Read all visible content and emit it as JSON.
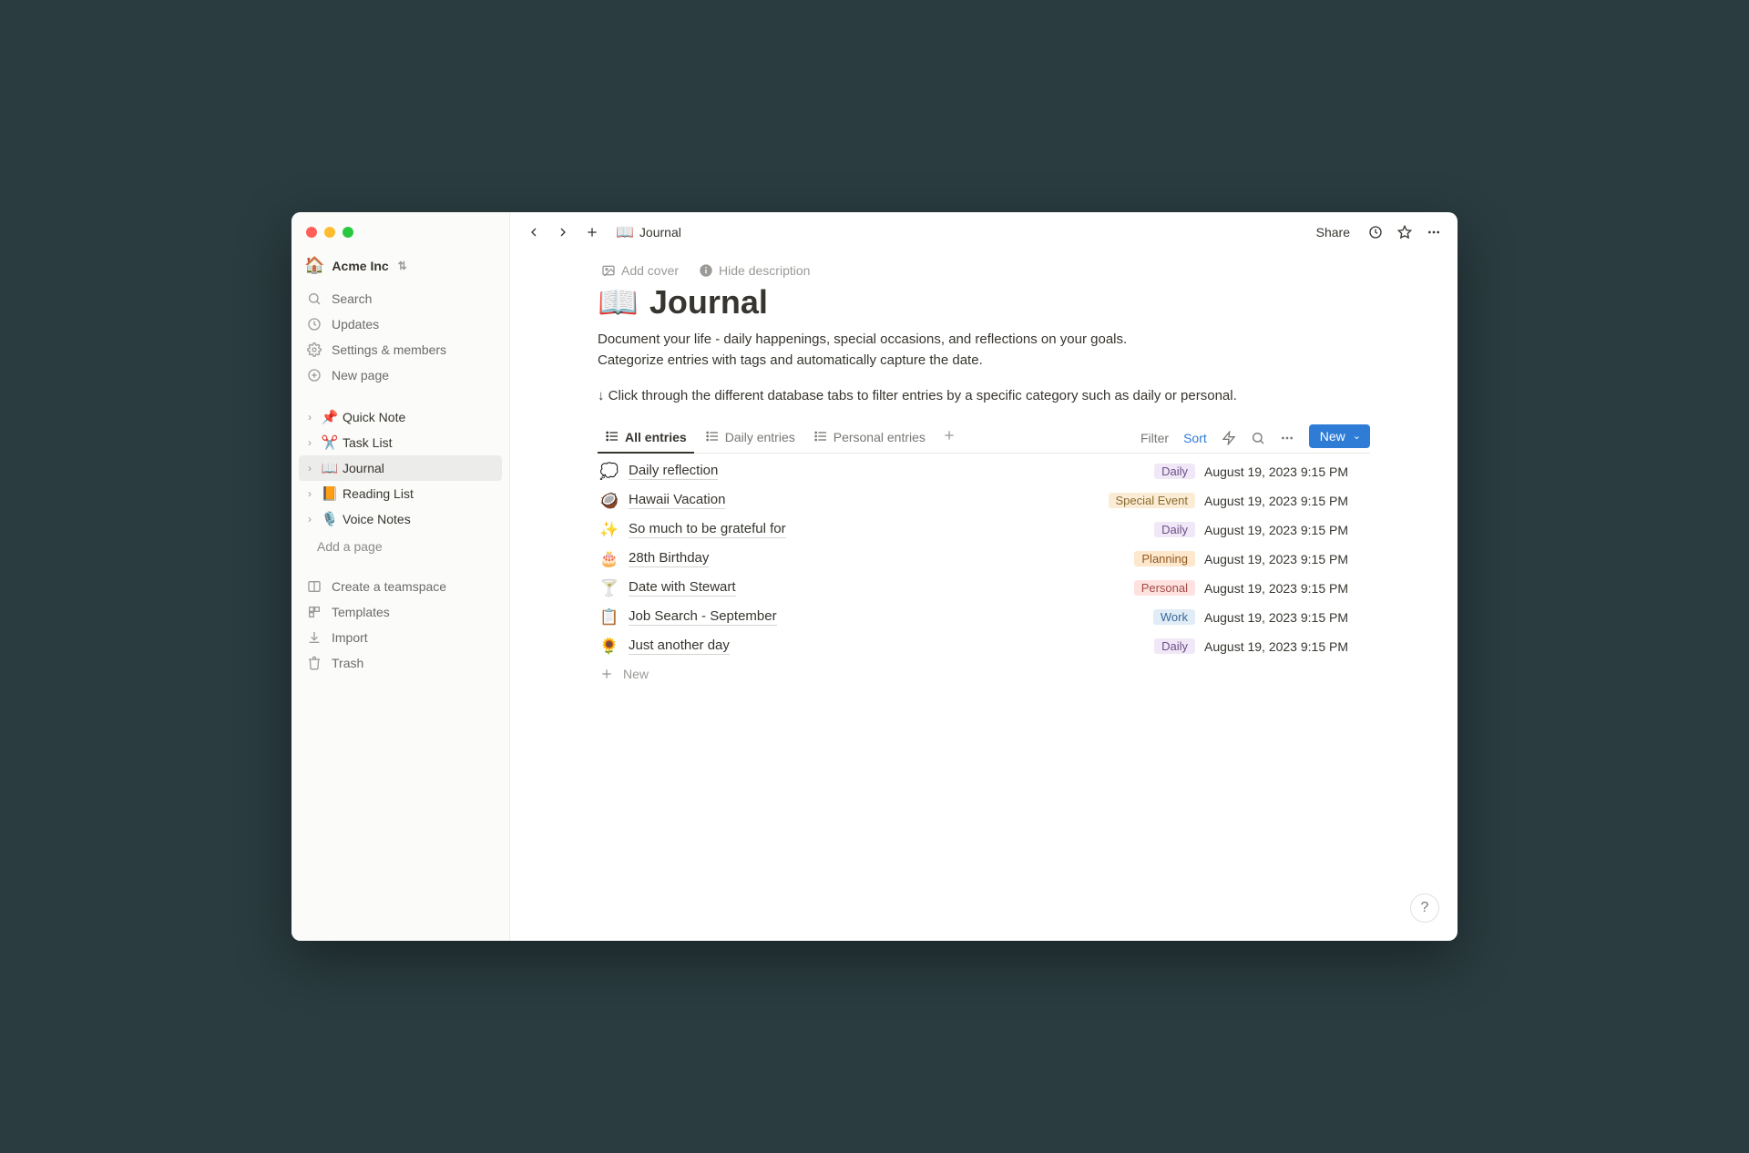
{
  "workspace": {
    "name": "Acme Inc",
    "icon": "🏠"
  },
  "sidebar": {
    "search": "Search",
    "updates": "Updates",
    "settings": "Settings & members",
    "new_page": "New page",
    "pages": [
      {
        "emoji": "📌",
        "label": "Quick Note"
      },
      {
        "emoji": "✂️",
        "label": "Task List"
      },
      {
        "emoji": "📖",
        "label": "Journal"
      },
      {
        "emoji": "📙",
        "label": "Reading List"
      },
      {
        "emoji": "🎙️",
        "label": "Voice Notes"
      }
    ],
    "add_page": "Add a page",
    "teamspace": "Create a teamspace",
    "templates": "Templates",
    "import": "Import",
    "trash": "Trash"
  },
  "topbar": {
    "breadcrumb_icon": "📖",
    "breadcrumb": "Journal",
    "share": "Share"
  },
  "cover": {
    "add_cover": "Add cover",
    "hide_desc": "Hide description"
  },
  "page": {
    "icon": "📖",
    "title": "Journal",
    "description_l1": "Document your life - daily happenings, special occasions, and reflections on your goals.",
    "description_l2": "Categorize entries with tags and automatically capture the date.",
    "hint": "↓ Click through the different database tabs to filter entries by a specific category such as daily or personal."
  },
  "db": {
    "tabs": [
      {
        "label": "All entries",
        "active": true
      },
      {
        "label": "Daily entries",
        "active": false
      },
      {
        "label": "Personal entries",
        "active": false
      }
    ],
    "filter": "Filter",
    "sort": "Sort",
    "new_btn": "New",
    "new_row": "New"
  },
  "entries": [
    {
      "emoji": "💭",
      "title": "Daily reflection",
      "tag": "Daily",
      "tag_class": "tag-daily",
      "date": "August 19, 2023 9:15 PM"
    },
    {
      "emoji": "🥥",
      "title": "Hawaii Vacation",
      "tag": "Special Event",
      "tag_class": "tag-special",
      "date": "August 19, 2023 9:15 PM"
    },
    {
      "emoji": "✨",
      "title": "So much to be grateful for",
      "tag": "Daily",
      "tag_class": "tag-daily",
      "date": "August 19, 2023 9:15 PM"
    },
    {
      "emoji": "🎂",
      "title": "28th Birthday",
      "tag": "Planning",
      "tag_class": "tag-planning",
      "date": "August 19, 2023 9:15 PM"
    },
    {
      "emoji": "🍸",
      "title": "Date with Stewart",
      "tag": "Personal",
      "tag_class": "tag-personal",
      "date": "August 19, 2023 9:15 PM"
    },
    {
      "emoji": "📋",
      "title": "Job Search - September",
      "tag": "Work",
      "tag_class": "tag-work",
      "date": "August 19, 2023 9:15 PM"
    },
    {
      "emoji": "🌻",
      "title": "Just another day",
      "tag": "Daily",
      "tag_class": "tag-daily",
      "date": "August 19, 2023 9:15 PM"
    }
  ]
}
